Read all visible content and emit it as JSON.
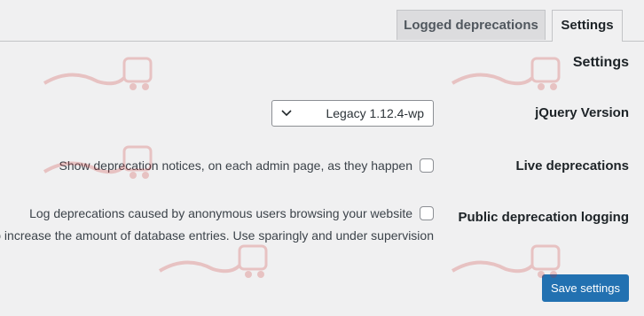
{
  "tabs": [
    {
      "label": "Logged deprecations",
      "active": false
    },
    {
      "label": "Settings",
      "active": true
    }
  ],
  "section_title": "Settings",
  "jquery": {
    "label": "jQuery Version",
    "selected": "Legacy 1.12.4-wp"
  },
  "live": {
    "label": "Live deprecations",
    "checkbox_text": "Show deprecation notices, on each admin page, as they happen",
    "checked": false
  },
  "public_logging": {
    "label": "Public deprecation logging",
    "checkbox_text": "Log deprecations caused by anonymous users browsing your website",
    "description": "o increase the amount of database entries. Use sparingly and under supervision",
    "checked": false
  },
  "save_button": "Save settings",
  "colors": {
    "accent": "#2271b1",
    "watermark": "#cc2222"
  }
}
